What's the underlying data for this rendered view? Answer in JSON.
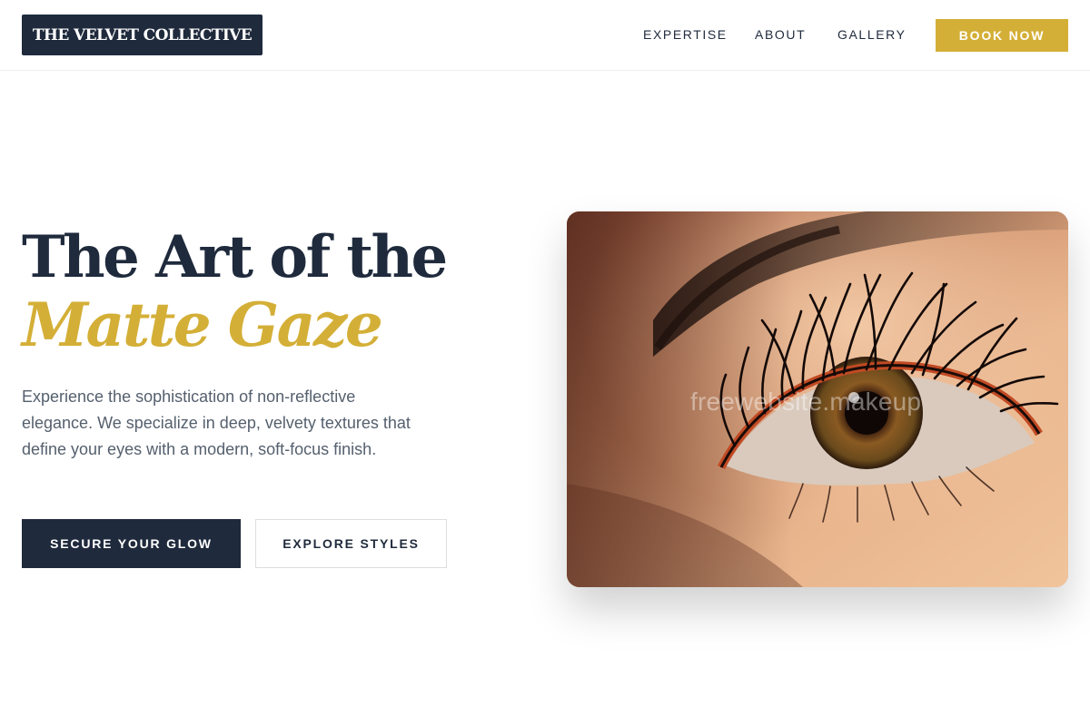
{
  "brand": {
    "logo_text": "THE VELVET COLLECTIVE"
  },
  "nav": {
    "items": [
      {
        "label": "EXPERTISE"
      },
      {
        "label": "ABOUT"
      },
      {
        "label": "GALLERY"
      }
    ],
    "cta_label": "BOOK NOW"
  },
  "hero": {
    "title_line1": "The Art of the",
    "title_line2": "Matte Gaze",
    "description": "Experience the sophistication of non-reflective elegance. We specialize in deep, velvety textures that define your eyes with a modern, soft-focus finish.",
    "primary_button": "SECURE YOUR GLOW",
    "secondary_button": "EXPLORE STYLES",
    "image_watermark": "freewebsite.makeup"
  },
  "colors": {
    "navy": "#1f2a3c",
    "gold": "#d4af37",
    "body_text": "#55606e",
    "background": "#ffffff"
  }
}
